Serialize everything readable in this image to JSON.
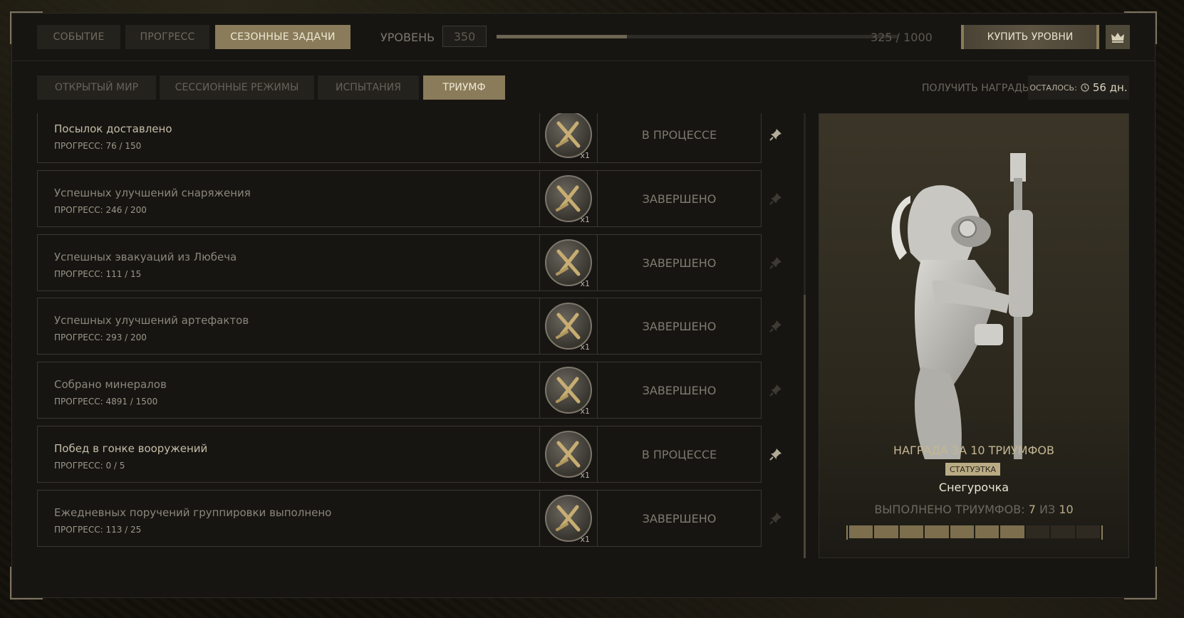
{
  "top_tabs": [
    {
      "label": "СОБЫТИЕ",
      "active": false
    },
    {
      "label": "ПРОГРЕСС",
      "active": false
    },
    {
      "label": "СЕЗОННЫЕ ЗАДАЧИ",
      "active": true
    }
  ],
  "level": {
    "label": "УРОВЕНЬ",
    "value": "350",
    "xp_text": "325 / 1000",
    "xp_fraction": 0.325
  },
  "buy_levels_label": "КУПИТЬ УРОВНИ",
  "crown_icon": "crown-icon",
  "sub_tabs": [
    {
      "label": "ОТКРЫТЫЙ МИР",
      "active": false
    },
    {
      "label": "СЕССИОННЫЕ РЕЖИМЫ",
      "active": false
    },
    {
      "label": "ИСПЫТАНИЯ",
      "active": false
    },
    {
      "label": "ТРИУМФ",
      "active": true
    }
  ],
  "get_rewards_label": "ПОЛУЧИТЬ НАГРАДЫ",
  "remaining": {
    "label": "ОСТАЛОСЬ:",
    "value": "56 дн."
  },
  "tasks": [
    {
      "title": "Посылок доставлено",
      "progress": "ПРОГРЕСС: 76 / 150",
      "multiplier": "x1",
      "status": "В ПРОЦЕССЕ",
      "active": true
    },
    {
      "title": "Успешных улучшений снаряжения",
      "progress": "ПРОГРЕСС: 246 / 200",
      "multiplier": "x1",
      "status": "ЗАВЕРШЕНО",
      "active": false
    },
    {
      "title": "Успешных эвакуаций из Любеча",
      "progress": "ПРОГРЕСС: 111 / 15",
      "multiplier": "x1",
      "status": "ЗАВЕРШЕНО",
      "active": false
    },
    {
      "title": "Успешных улучшений артефактов",
      "progress": "ПРОГРЕСС: 293 / 200",
      "multiplier": "x1",
      "status": "ЗАВЕРШЕНО",
      "active": false
    },
    {
      "title": "Собрано минералов",
      "progress": "ПРОГРЕСС: 4891 / 1500",
      "multiplier": "x1",
      "status": "ЗАВЕРШЕНО",
      "active": false
    },
    {
      "title": "Побед в гонке вооружений",
      "progress": "ПРОГРЕСС: 0 / 5",
      "multiplier": "x1",
      "status": "В ПРОЦЕССЕ",
      "active": true
    },
    {
      "title": "Ежедневных поручений группировки выполнено",
      "progress": "ПРОГРЕСС: 113 / 25",
      "multiplier": "x1",
      "status": "ЗАВЕРШЕНО",
      "active": false
    }
  ],
  "reward": {
    "title": "НАГРАДА ЗА 10 ТРИУМФОВ",
    "badge": "СТАТУЭТКА",
    "name": "Снегурочка",
    "done_prefix": "ВЫПОЛНЕНО ТРИУМФОВ:",
    "done_count": "7",
    "done_of": "ИЗ",
    "done_total": "10",
    "completed": 7,
    "total": 10
  },
  "colors": {
    "accent": "#8a7c5a",
    "segment_on": "#7d6f4e"
  }
}
